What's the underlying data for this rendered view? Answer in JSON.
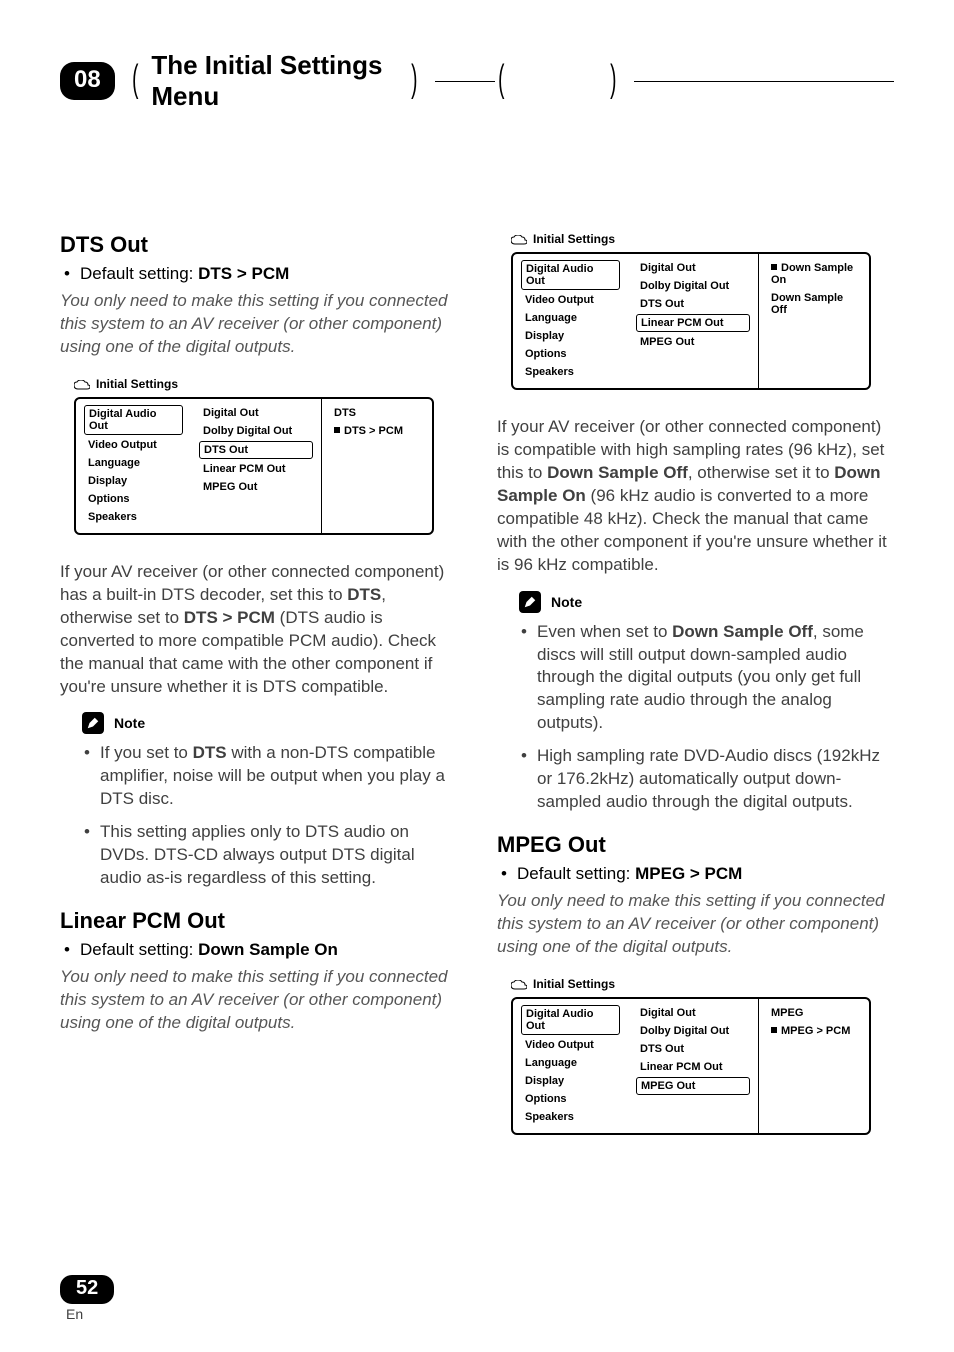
{
  "header": {
    "chapter_number": "08",
    "chapter_title": "The Initial Settings Menu"
  },
  "left_column": {
    "dts_out": {
      "heading": "DTS Out",
      "default_label": "Default setting: ",
      "default_value": "DTS > PCM",
      "intro_italic": "You only need to make this setting if you connected this system to an AV receiver (or other component) using one of the digital outputs.",
      "body_before": "If your AV receiver (or other connected component) has a built-in DTS decoder, set this to ",
      "bold1": "DTS",
      "body_mid": ", otherwise set to ",
      "bold2": "DTS > PCM",
      "body_after": " (DTS audio is converted to more compatible PCM audio). Check the manual that came with the other component if you're unsure whether it is DTS compatible.",
      "note_label": "Note",
      "note_items": [
        {
          "pre": "If you set to ",
          "bold": "DTS",
          "post": " with a non-DTS compatible amplifier, noise will be output when you play a DTS disc."
        },
        {
          "pre": "This setting applies only to DTS audio on DVDs. DTS-CD always output DTS digital audio as-is regardless of this setting.",
          "bold": "",
          "post": ""
        }
      ]
    },
    "linear_pcm_out": {
      "heading": "Linear PCM Out",
      "default_label": "Default setting: ",
      "default_value": "Down Sample On",
      "intro_italic": "You only need to make this setting if you connected this system to an AV receiver (or other component) using one of the digital outputs."
    }
  },
  "right_column": {
    "linear_body": {
      "pre": "If your AV receiver (or other connected component) is compatible with high sampling rates (96 kHz), set this to ",
      "bold1": "Down Sample Off",
      "mid1": ", otherwise set it to ",
      "bold2": "Down Sample On",
      "post": " (96 kHz audio is converted to a more compatible 48 kHz). Check the manual that came with the other component if you're unsure whether it is 96 kHz compatible."
    },
    "note_label": "Note",
    "note_items": [
      {
        "pre": "Even when set to ",
        "bold": "Down Sample Off",
        "post": ", some discs will still output down-sampled audio through the digital outputs (you only get full sampling rate audio through the analog outputs)."
      },
      {
        "pre": "High sampling rate DVD-Audio discs (192kHz or 176.2kHz) automatically output down-sampled audio through the digital outputs.",
        "bold": "",
        "post": ""
      }
    ],
    "mpeg_out": {
      "heading": "MPEG Out",
      "default_label": "Default setting: ",
      "default_value": "MPEG > PCM",
      "intro_italic": "You only need to make this setting if you connected this system to an AV receiver (or other component) using one of the digital outputs."
    }
  },
  "settings_screens": {
    "title": "Initial Settings",
    "col1": [
      "Digital Audio Out",
      "Video Output",
      "Language",
      "Display",
      "Options",
      "Speakers"
    ],
    "col2": [
      "Digital Out",
      "Dolby Digital Out",
      "DTS Out",
      "Linear PCM Out",
      "MPEG Out"
    ],
    "dts": {
      "selected_c1": 0,
      "selected_c2": 2,
      "c3": [
        "DTS",
        "DTS > PCM"
      ],
      "marked": 1
    },
    "linear": {
      "selected_c1": 0,
      "selected_c2": 3,
      "c3": [
        "Down Sample On",
        "Down Sample Off"
      ],
      "marked": 0
    },
    "mpeg": {
      "selected_c1": 0,
      "selected_c2": 4,
      "c3": [
        "MPEG",
        "MPEG > PCM"
      ],
      "marked": 1
    }
  },
  "footer": {
    "page": "52",
    "lang": "En"
  }
}
